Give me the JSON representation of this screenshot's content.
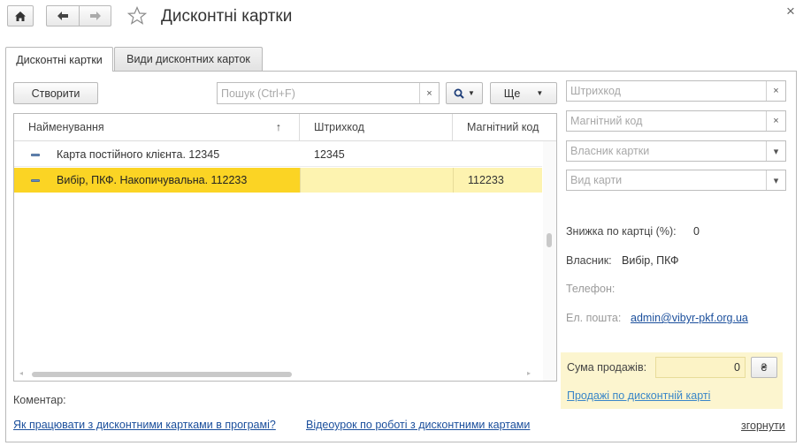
{
  "window": {
    "title": "Дисконтні картки",
    "close_glyph": "×"
  },
  "tabs": [
    {
      "label": "Дисконтні картки",
      "active": true
    },
    {
      "label": "Види дисконтних карток",
      "active": false
    }
  ],
  "toolbar": {
    "create_label": "Створити",
    "search_placeholder": "Пошук (Ctrl+F)",
    "clear_glyph": "×",
    "more_label": "Ще"
  },
  "table": {
    "columns": [
      {
        "label": "Найменування",
        "sort_glyph": "↑"
      },
      {
        "label": "Штрихкод"
      },
      {
        "label": "Магнітний код"
      }
    ],
    "rows": [
      {
        "name": "Карта постійного клієнта. 12345",
        "barcode": "12345",
        "magnetic": "",
        "selected": false
      },
      {
        "name": "Вибір, ПКФ. Накопичувальна. 112233",
        "barcode": "",
        "magnetic": "112233",
        "selected": true
      }
    ]
  },
  "filters": {
    "barcode_placeholder": "Штрихкод",
    "magnetic_placeholder": "Магнітний код",
    "owner_placeholder": "Власник картки",
    "type_placeholder": "Вид карти",
    "clear_glyph": "×",
    "dropdown_glyph": "▾"
  },
  "details": {
    "discount_label": "Знижка по картці (%):",
    "discount_value": "0",
    "owner_label": "Власник:",
    "owner_value": "Вибір, ПКФ",
    "phone_label": "Телефон:",
    "email_label": "Ел. пошта:",
    "email_value": "admin@vibyr-pkf.org.ua"
  },
  "sales": {
    "label": "Сума продажів:",
    "value": "0",
    "currency_glyph": "₴",
    "link": "Продажі по дисконтній карті"
  },
  "comment_label": "Коментар:",
  "bottom_links": {
    "help_link": "Як працювати з дисконтними картками в програмі?",
    "video_link": "Відеоурок по роботі з дисконтними картами",
    "collapse_link": "згорнути"
  },
  "colors": {
    "selected_row": "#fbd424",
    "selected_row_light": "#fdf3b0",
    "sales_panel": "#fcf5cf",
    "link": "#1b4f9c"
  },
  "icons": {
    "home": "home-icon",
    "back": "arrow-left-icon",
    "forward": "arrow-right-icon",
    "favorite": "star-icon",
    "search": "search-icon"
  }
}
